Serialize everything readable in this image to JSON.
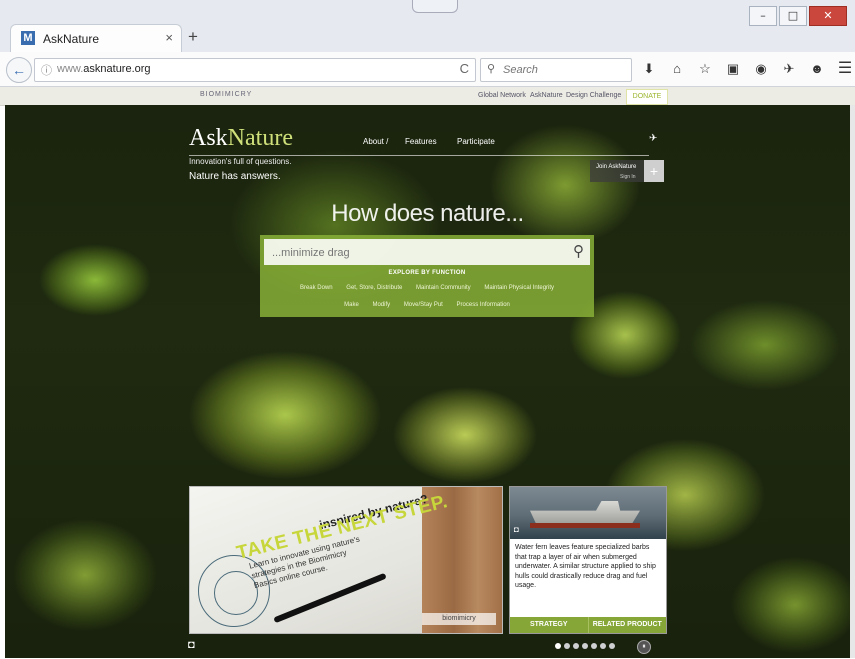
{
  "window": {
    "controls": [
      "–",
      "□",
      "✕"
    ]
  },
  "tab": {
    "favicon": "M",
    "title": "AskNature",
    "close": "×",
    "new_tab": "+"
  },
  "nav": {
    "back_icon": "←",
    "info_icon": "ⓘ",
    "url_prefix": "www.",
    "url_domain": "asknature.org",
    "reload_icon": "C",
    "search_placeholder": "Search",
    "search_icon": "⚲",
    "tools": [
      "⬇",
      "⌂",
      "☆",
      "▣",
      "◉",
      "✈",
      "☻",
      "☰"
    ]
  },
  "topstrip": {
    "brand": "BIOMIMICRY",
    "links": [
      "Global Network",
      "AskNature",
      "Design Challenge"
    ],
    "donate": "DONATE"
  },
  "hero": {
    "logo_ask": "Ask",
    "logo_nature": "Nature",
    "tagline1": "Innovation's full of questions.",
    "tagline2": "Nature has answers.",
    "nav": [
      "About /",
      "Features",
      "Participate"
    ],
    "bird_icon": "✈",
    "join_line1": "Join AskNature",
    "join_line2": "Sign In",
    "join_plus": "+",
    "headline": "How does nature...",
    "search_placeholder": "...minimize drag",
    "search_icon": "⚲",
    "explore_label": "EXPLORE BY FUNCTION",
    "functions_row1": [
      "Break Down",
      "Get, Store, Distribute",
      "Maintain Community",
      "Maintain Physical Integrity"
    ],
    "functions_row2": [
      "Make",
      "Modify",
      "Move/Stay Put",
      "Process Information"
    ]
  },
  "promo": {
    "inspired": "inspired by nature?",
    "take": "TAKE THE NEXT STEP.",
    "learn": "Learn to innovate using nature's strategies in the Biomimicry Basics online course.",
    "brand": "biomimicry"
  },
  "card": {
    "cam_icon": "◘",
    "description": "Water fern leaves feature specialized barbs that trap a layer of air when submerged underwater. A similar structure applied to ship hulls could drastically reduce drag and fuel usage.",
    "button1": "STRATEGY",
    "button2": "RELATED PRODUCT"
  },
  "carousel": {
    "slides": 7,
    "active_index": 0,
    "pause_icon": "⏸",
    "camera_icon": "◘"
  }
}
